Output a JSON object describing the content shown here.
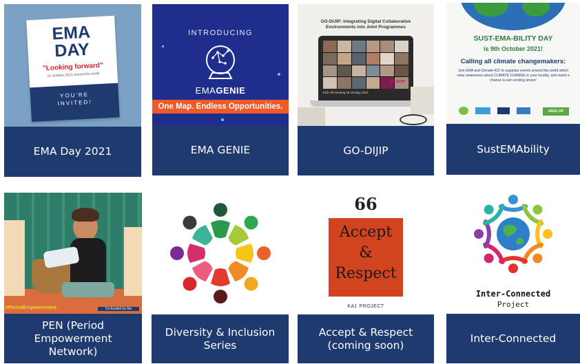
{
  "cards": [
    {
      "caption": "EMA Day 2021",
      "poster": {
        "title_line1": "EMA",
        "title_line2": "DAY",
        "tagline": "\"Looking forward\"",
        "subline": "16 October 2021 around the world",
        "invite_line1": "YOU'RE",
        "invite_line2": "INVITED!"
      }
    },
    {
      "caption": "EMA GENIE",
      "poster": {
        "intro": "INTRODUCING",
        "brand_a": "EMA",
        "brand_b": "GENIE",
        "banner": "One Map. Endless Opportunities."
      }
    },
    {
      "caption": "GO-DIJIP",
      "poster": {
        "heading": "GO-DIJIP: Integrating Digital Collaborative Environments into Joint Programmes",
        "footer": "Kick-off meeting 18-19 May 2021",
        "laptop_logo": "GO DIJIP"
      }
    },
    {
      "caption": "SustEMAbility",
      "poster": {
        "arc_title": "SUST-EMA-BILITY DAY",
        "date_line": "is 9th October 2021!",
        "headline": "Calling all climate changemakers:",
        "body": "Join EMA and Climate-KIC to organise events around the world which raise awareness about CLIMATE CHANGE in your locality, and stand a chance to win exciting prizes!",
        "signup": "SIGN UP"
      }
    },
    {
      "caption": "PEN (Period Empowerment Network)",
      "poster": {
        "hashtag": "#PeriodEmpowerment",
        "cofunded": "Co-funded by the"
      }
    },
    {
      "caption": "Diversity & Inclusion Series"
    },
    {
      "caption": "Accept & Respect (coming soon)",
      "poster": {
        "quote_mark": "66",
        "line1": "Accept",
        "line2": "&",
        "line3": "Respect",
        "project": "KA1 PROJECT"
      }
    },
    {
      "caption": "Inter-Connected",
      "poster": {
        "title": "Inter-Connected",
        "subtitle": "Project"
      }
    }
  ],
  "colors": {
    "caption_bg": "#1e3a6e",
    "ema_day_bg": "#7ba1c4",
    "genie_bg": "#1f2d8c",
    "genie_banner": "#f05a28",
    "accept_red": "#d24420"
  }
}
